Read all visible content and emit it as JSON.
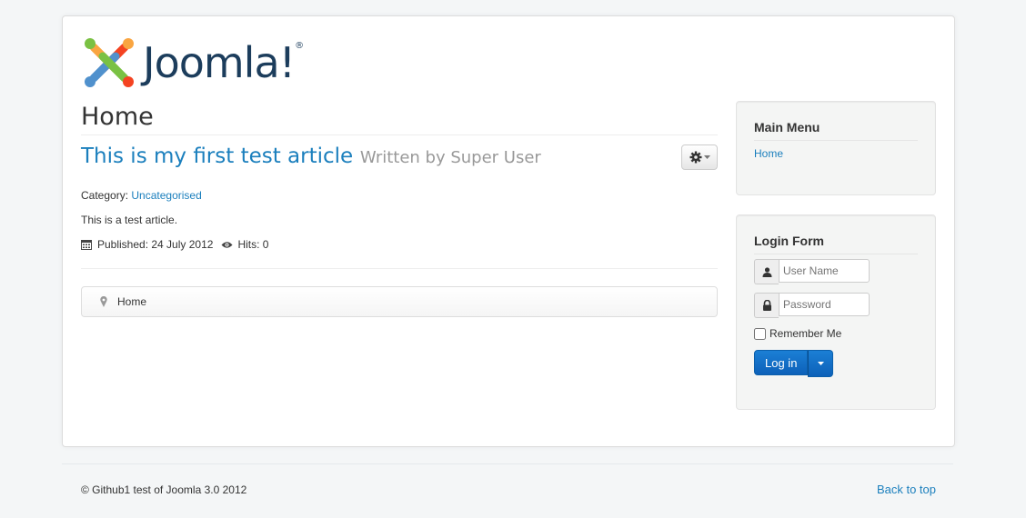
{
  "site": {
    "logo_text": "Joomla!",
    "logo_reg": "®",
    "colors": {
      "link": "#1b7fbd",
      "logo": "#1c3d5c",
      "primary_button": "#0d61b9"
    }
  },
  "page_title": "Home",
  "article": {
    "title": "This is my first test article",
    "author": "Written by Super User",
    "category_label": "Category:",
    "category_value": "Uncategorised",
    "body": "This is a test article.",
    "published": "Published: 24 July 2012",
    "hits": "Hits: 0"
  },
  "breadcrumb": {
    "current": "Home"
  },
  "main_menu": {
    "title": "Main Menu",
    "items": [
      {
        "label": "Home"
      }
    ]
  },
  "login_form": {
    "title": "Login Form",
    "username_placeholder": "User Name",
    "password_placeholder": "Password",
    "remember_label": "Remember Me",
    "login_button": "Log in"
  },
  "footer": {
    "copyright": "© Github1 test of Joomla 3.0 2012",
    "back_to_top": "Back to top"
  },
  "icons": [
    "joomla-logo-icon",
    "gear-icon",
    "calendar-icon",
    "eye-icon",
    "map-marker-icon",
    "user-icon",
    "lock-icon",
    "caret-down-icon"
  ]
}
